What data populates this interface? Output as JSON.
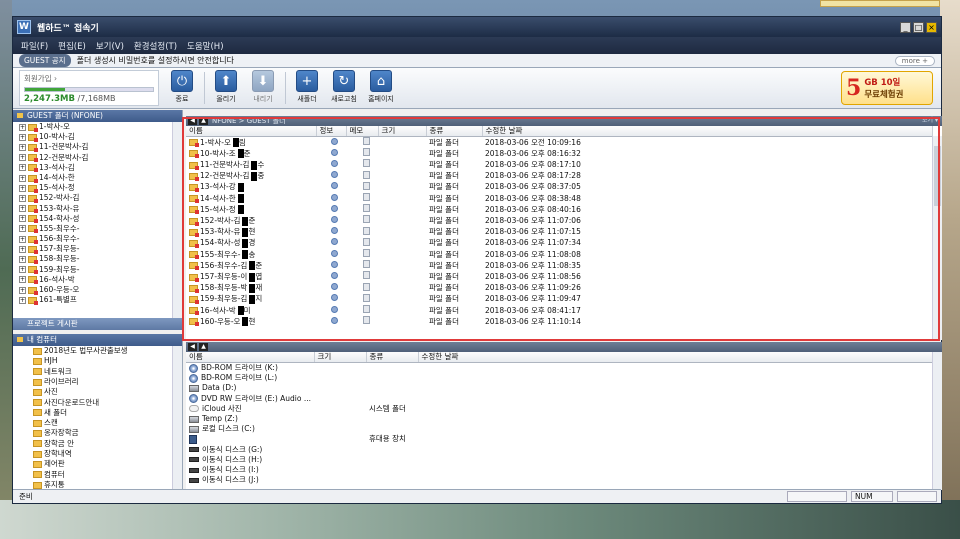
{
  "window": {
    "title": "웹하드™ 접속기",
    "logo": "W"
  },
  "menu": [
    "파일(F)",
    "편집(E)",
    "보기(V)",
    "환경설정(T)",
    "도움말(H)"
  ],
  "notice": {
    "badge": "GUEST 공지",
    "text": "폴더 생성시 비밀번호를 설정하시면 안전합니다",
    "more": "more +"
  },
  "account": {
    "label": "회원가입 ›",
    "used": "2,247.3MB",
    "total": "/7,168MB",
    "usage_fraction": 0.31
  },
  "toolbar": [
    {
      "label": "종료",
      "icon": "power-icon",
      "enabled": true,
      "glyph": "⏻"
    },
    {
      "label": "올리기",
      "icon": "upload-icon",
      "enabled": true,
      "glyph": "⬆"
    },
    {
      "label": "내리기",
      "icon": "download-icon",
      "enabled": false,
      "glyph": "⬇"
    },
    {
      "label": "새폴더",
      "icon": "new-folder-icon",
      "enabled": true,
      "glyph": "+"
    },
    {
      "label": "새로고침",
      "icon": "refresh-icon",
      "enabled": true,
      "glyph": "↻"
    },
    {
      "label": "홈페이지",
      "icon": "home-icon",
      "enabled": true,
      "glyph": "⌂"
    }
  ],
  "promo": {
    "big": "5",
    "line1": "GB 10일",
    "line2": "무료체험권"
  },
  "guest_panel": {
    "header": "GUEST 폴더 (NFONE)",
    "items": [
      "1-박사-오",
      "10-박사-김",
      "11-건문박사-김",
      "12-건문박사-김",
      "13-석사-김",
      "14-석사-한",
      "15-석사-정",
      "152-박사-김",
      "153-학사-유",
      "154-학사-성",
      "155-최우수-",
      "156-최우수-",
      "157-최우등-",
      "158-최우등-",
      "159-최우등-",
      "16-석사-박",
      "160-우등-오",
      "161-특별프"
    ],
    "project_tab": "프로젝트 게시판"
  },
  "my_computer": {
    "header": "내 컴퓨터",
    "items": [
      "2018년도 법무사관출보생",
      "HJH",
      "네트워크",
      "라이브러리",
      "사진",
      "사진다운로드안내",
      "새 폴더",
      "스캔",
      "옹자장학금",
      "장학금 안",
      "장학내역",
      "제어판",
      "컴퓨터",
      "휴지통"
    ]
  },
  "file_list": {
    "path": "NFONE > GUEST 폴더",
    "right_label": "보기 ▾",
    "columns": [
      "이름",
      "정보",
      "메모",
      "크기",
      "종류",
      "수정한 날짜"
    ],
    "rows": [
      {
        "name": "1-박사-오",
        "suffix": "림",
        "type": "파일 폴더",
        "date": "2018-03-06 오전 10:09:16"
      },
      {
        "name": "10-박사-조",
        "suffix": "준",
        "type": "파일 폴더",
        "date": "2018-03-06 오후 08:16:32"
      },
      {
        "name": "11-건문박사-김",
        "suffix": "수",
        "type": "파일 폴더",
        "date": "2018-03-06 오후 08:17:10"
      },
      {
        "name": "12-건문박사-김",
        "suffix": "중",
        "type": "파일 폴더",
        "date": "2018-03-06 오후 08:17:28"
      },
      {
        "name": "13-석사-강",
        "suffix": "",
        "type": "파일 폴더",
        "date": "2018-03-06 오후 08:37:05"
      },
      {
        "name": "14-석사-한",
        "suffix": "",
        "type": "파일 폴더",
        "date": "2018-03-06 오후 08:38:48"
      },
      {
        "name": "15-석사-정",
        "suffix": "",
        "type": "파일 폴더",
        "date": "2018-03-06 오후 08:40:16"
      },
      {
        "name": "152-박사-김",
        "suffix": "준",
        "type": "파일 폴더",
        "date": "2018-03-06 오후 11:07:06"
      },
      {
        "name": "153-학사-유",
        "suffix": "현",
        "type": "파일 폴더",
        "date": "2018-03-06 오후 11:07:15"
      },
      {
        "name": "154-학사-성",
        "suffix": "경",
        "type": "파일 폴더",
        "date": "2018-03-06 오후 11:07:34"
      },
      {
        "name": "155-최우수-",
        "suffix": "송",
        "type": "파일 폴더",
        "date": "2018-03-06 오후 11:08:08"
      },
      {
        "name": "156-최우수-김",
        "suffix": "준",
        "type": "파일 폴더",
        "date": "2018-03-06 오후 11:08:35"
      },
      {
        "name": "157-최우등-이",
        "suffix": "엽",
        "type": "파일 폴더",
        "date": "2018-03-06 오후 11:08:56"
      },
      {
        "name": "158-최우등-박",
        "suffix": "재",
        "type": "파일 폴더",
        "date": "2018-03-06 오후 11:09:26"
      },
      {
        "name": "159-최우등-김",
        "suffix": "지",
        "type": "파일 폴더",
        "date": "2018-03-06 오후 11:09:47"
      },
      {
        "name": "16-석사-박",
        "suffix": "미",
        "type": "파일 폴더",
        "date": "2018-03-06 오후 08:41:17"
      },
      {
        "name": "160-우등-오",
        "suffix": "현",
        "type": "파일 폴더",
        "date": "2018-03-06 오후 11:10:14"
      }
    ]
  },
  "local_list": {
    "columns": [
      "이름",
      "크기",
      "종류",
      "수정한 날짜"
    ],
    "rows": [
      {
        "name": "BD-ROM 드라이브 (K:)",
        "icon": "disc",
        "type": ""
      },
      {
        "name": "BD-ROM 드라이브 (L:)",
        "icon": "disc",
        "type": ""
      },
      {
        "name": "Data (D:)",
        "icon": "drive",
        "type": ""
      },
      {
        "name": "DVD RW 드라이브 (E:) Audio ...",
        "icon": "disc",
        "type": ""
      },
      {
        "name": "iCloud 사진",
        "icon": "cloud",
        "type": "시스템 폴더"
      },
      {
        "name": "Temp (Z:)",
        "icon": "drive",
        "type": ""
      },
      {
        "name": "로컬 디스크 (C:)",
        "icon": "drive",
        "type": ""
      },
      {
        "name": "",
        "icon": "phone",
        "type": "휴대용 장치"
      },
      {
        "name": "이동식 디스크 (G:)",
        "icon": "removable",
        "type": ""
      },
      {
        "name": "이동식 디스크 (H:)",
        "icon": "removable",
        "type": ""
      },
      {
        "name": "이동식 디스크 (I:)",
        "icon": "removable",
        "type": ""
      },
      {
        "name": "이동식 디스크 (J:)",
        "icon": "removable",
        "type": ""
      }
    ]
  },
  "status": {
    "left": "준비",
    "num": "NUM"
  }
}
